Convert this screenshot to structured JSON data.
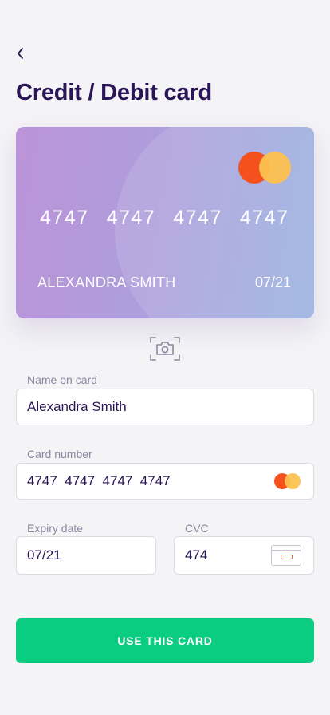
{
  "header": {
    "title": "Credit / Debit card",
    "back_icon": "chevron-left-icon"
  },
  "card": {
    "number_groups": [
      "4747",
      "4747",
      "4747",
      "4747"
    ],
    "holder_name": "ALEXANDRA SMITH",
    "expiry": "07/21",
    "brand_icon": "mastercard-logo",
    "colors": {
      "gradient_start": "#bc93d9",
      "gradient_end": "#97b0e0"
    }
  },
  "scan": {
    "icon": "camera-scan-icon"
  },
  "form": {
    "name": {
      "label": "Name on card",
      "value": "Alexandra Smith"
    },
    "number": {
      "label": "Card number",
      "value": "4747  4747  4747  4747"
    },
    "expiry": {
      "label": "Expiry date",
      "value": "07/21"
    },
    "cvc": {
      "label": "CVC",
      "value": "474",
      "icon": "card-cvc-icon"
    }
  },
  "cta": {
    "label": "USE THIS CARD",
    "color": "#0bcd82"
  }
}
